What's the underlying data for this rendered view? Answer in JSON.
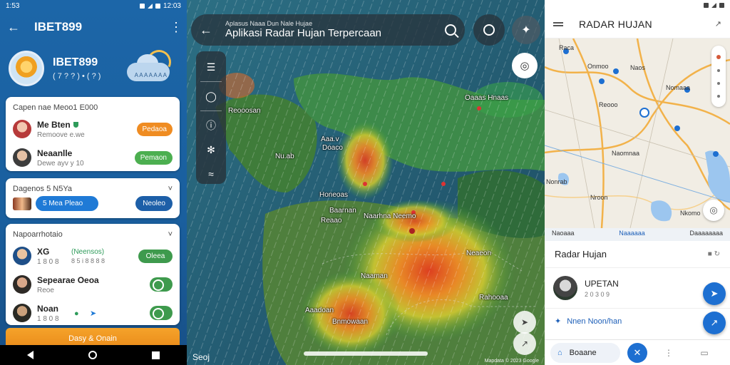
{
  "left": {
    "status_time": "1:53",
    "status_right": "12:03",
    "appbar_title": "IBET899",
    "profile": {
      "name": "IBET899",
      "sub": "( 7 ? ? ) • ( ? )",
      "weather_label": "A A A A A A A"
    },
    "card1": {
      "title": "Capen nae Meoo1 E000",
      "rows": [
        {
          "name": "Me Bten",
          "sub": "Remoove e.we",
          "action": "Pedaoa",
          "action_color": "#ef8c22"
        },
        {
          "name": "Neaanlle",
          "sub": "Dewe ayv y 10",
          "action": "Pemaon",
          "action_color": "#4caf50"
        }
      ]
    },
    "card2": {
      "title": "Dagenos 5 N5Ya",
      "chip_primary": "5 Mea Pleao",
      "chip_secondary": "Neoleo"
    },
    "card3": {
      "title": "Napoarrhotaio",
      "rows": [
        {
          "name": "XG",
          "sub": "1 8 0 8",
          "mid": "(Neensos)",
          "mid2": "8 5 i 8 8 8 8",
          "action": "Oleea"
        },
        {
          "name": "Sepearae Oeoa",
          "sub": "Reoe"
        },
        {
          "name": "Noan",
          "sub": "1 8 0 8"
        }
      ]
    },
    "bottom_button": "Dasy & Onain"
  },
  "mid": {
    "search_small": "Aplasus Naaa Dun Nale Hujae",
    "search_title": "Aplikasi Radar Hujan Terpercaan",
    "attribution": "Seoj",
    "credit": "Mapdata © 2023 Google",
    "labels": [
      "Oaaas Hnaas",
      "Reooosan",
      "Aaa.v",
      "Doaco",
      "Nu.ab",
      "Honeoas",
      "Baarnan",
      "Naarhna Neemo",
      "Reaao",
      "Neaeon",
      "Naaman",
      "Rahooaa",
      "Aaadoan",
      "Bnmowaan"
    ]
  },
  "right": {
    "title": "RADAR HUJAN",
    "map_labels": [
      "Raca",
      "Onmoo",
      "Naos",
      "Nomaaa",
      "Reooo",
      "Naomnaa",
      "Nonrab",
      "Nroon",
      "Nkomo"
    ],
    "tabs": [
      "Naoaaa",
      "Naaaaaa",
      "Daaaaaaaa"
    ],
    "section_title": "Radar Hujan",
    "user_name": "UPETAN",
    "user_sub": "2 0 3 0 9",
    "link": "Nnen Noon/han",
    "bottom_pill": "Boaane"
  }
}
